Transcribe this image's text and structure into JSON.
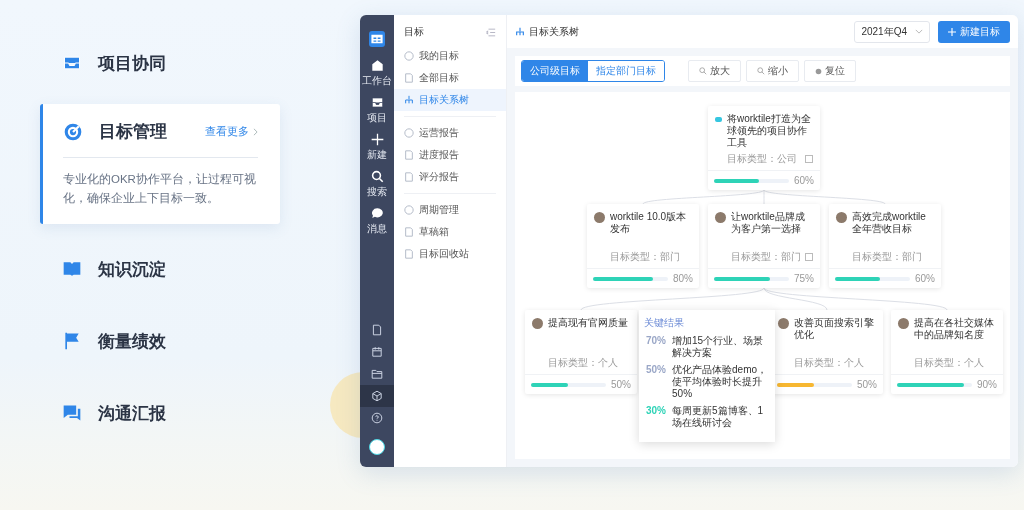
{
  "features": [
    {
      "label": "项目协同",
      "selected": false
    },
    {
      "label": "目标管理",
      "selected": true,
      "link": "查看更多",
      "description": "专业化的OKR协作平台，让过程可视化，确保企业上下目标一致。"
    },
    {
      "label": "知识沉淀",
      "selected": false
    },
    {
      "label": "衡量绩效",
      "selected": false
    },
    {
      "label": "沟通汇报",
      "selected": false
    }
  ],
  "rail": {
    "items": [
      {
        "label": "工作台"
      },
      {
        "label": "项目"
      },
      {
        "label": "新建"
      },
      {
        "label": "搜索"
      },
      {
        "label": "消息"
      }
    ],
    "bottom_icons": [
      {
        "selected": false
      },
      {
        "selected": false
      },
      {
        "selected": false
      },
      {
        "selected": true
      },
      {
        "selected": false
      }
    ]
  },
  "sidebar": {
    "title": "目标",
    "groups": [
      [
        {
          "label": "我的目标",
          "selected": false
        },
        {
          "label": "全部目标",
          "selected": false
        },
        {
          "label": "目标关系树",
          "selected": true
        }
      ],
      [
        {
          "label": "运营报告",
          "selected": false
        },
        {
          "label": "进度报告",
          "selected": false
        },
        {
          "label": "评分报告",
          "selected": false
        }
      ],
      [
        {
          "label": "周期管理",
          "selected": false
        },
        {
          "label": "草稿箱",
          "selected": false
        },
        {
          "label": "目标回收站",
          "selected": false
        }
      ]
    ]
  },
  "header": {
    "title": "目标关系树",
    "period": "2021年Q4",
    "new_button": "新建目标"
  },
  "toolbar": {
    "scope_tabs": [
      {
        "label": "公司级目标",
        "selected": true
      },
      {
        "label": "指定部门目标",
        "selected": false
      }
    ],
    "buttons": [
      {
        "label": "放大"
      },
      {
        "label": "缩小"
      },
      {
        "label": "复位"
      }
    ]
  },
  "tree": {
    "nodes": [
      {
        "title": "将worktile打造为全球领先的项目协作工具",
        "type": "目标类型：公司",
        "percent": "60%",
        "level": 0.6,
        "color": "#2ed3b7",
        "collapse": true
      },
      {
        "title": "worktile 10.0版本发布",
        "type": "目标类型：部门",
        "percent": "80%",
        "level": 0.8,
        "color": "#2ed3b7",
        "collapse": false
      },
      {
        "title": "让worktile品牌成为客户第一选择",
        "type": "目标类型：部门",
        "percent": "75%",
        "level": 0.75,
        "color": "#2ed3b7",
        "collapse": true
      },
      {
        "title": "高效完成worktile 全年营收目标",
        "type": "目标类型：部门",
        "percent": "60%",
        "level": 0.6,
        "color": "#2ed3b7",
        "collapse": false
      },
      {
        "title": "提高现有官网质量",
        "type": "目标类型：个人",
        "percent": "50%",
        "level": 0.5,
        "color": "#2ed3b7",
        "collapse": false
      },
      {
        "title": "改善页面搜索引擎优化",
        "type": "目标类型：个人",
        "percent": "50%",
        "level": 0.5,
        "color": "#f7b731",
        "collapse": false
      },
      {
        "title": "提高在各社交媒体中的品牌知名度",
        "type": "目标类型：个人",
        "percent": "90%",
        "level": 0.9,
        "color": "#2ed3b7",
        "collapse": false
      }
    ],
    "popup": {
      "title": "关键结果",
      "items": [
        {
          "percent": "70%",
          "text": "增加15个行业、场景解决方案",
          "color": "#9aa7c7"
        },
        {
          "percent": "50%",
          "text": "优化产品体验demo，使平均体验时长提升50%",
          "color": "#9aa7c7"
        },
        {
          "percent": "30%",
          "text": "每周更新5篇博客、1场在线研讨会",
          "color": "#2ed3b7"
        }
      ]
    }
  }
}
